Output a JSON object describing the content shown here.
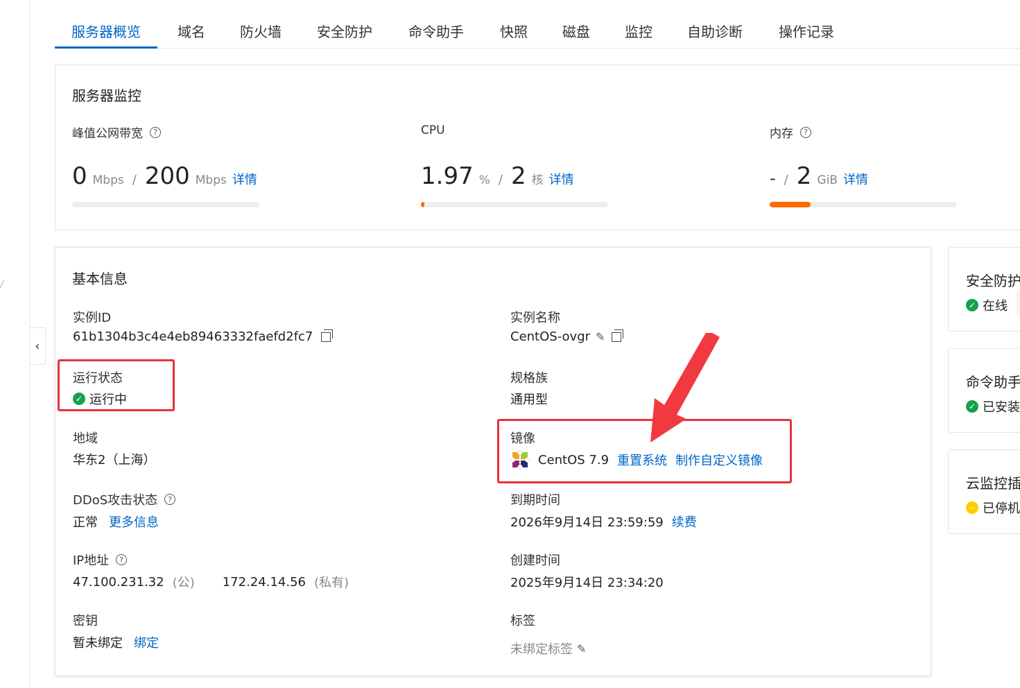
{
  "tabs": [
    "服务器概览",
    "域名",
    "防火墙",
    "安全防护",
    "命令助手",
    "快照",
    "磁盘",
    "监控",
    "自助诊断",
    "操作记录"
  ],
  "monitor": {
    "title": "服务器监控",
    "bandwidth": {
      "label": "峰值公网带宽",
      "used": "0",
      "used_unit": "Mbps",
      "total": "200",
      "total_unit": "Mbps",
      "link": "详情",
      "usage_fraction": 0.0
    },
    "cpu": {
      "label": "CPU",
      "used": "1.97",
      "used_unit": "%",
      "total": "2",
      "total_unit": "核",
      "link": "详情",
      "usage_fraction": 0.02
    },
    "memory": {
      "label": "内存",
      "used": "-",
      "total": "2",
      "total_unit": "GiB",
      "link": "详情",
      "usage_fraction": 0.22
    }
  },
  "basic": {
    "title": "基本信息",
    "instance_id": {
      "label": "实例ID",
      "value": "61b1304b3c4e4eb89463332faefd2fc7"
    },
    "instance_name": {
      "label": "实例名称",
      "value": "CentOS-ovgr"
    },
    "run_status": {
      "label": "运行状态",
      "value": "运行中"
    },
    "spec_family": {
      "label": "规格族",
      "value": "通用型"
    },
    "region": {
      "label": "地域",
      "value": "华东2（上海）"
    },
    "image": {
      "label": "镜像",
      "value": "CentOS 7.9",
      "reset_link": "重置系统",
      "custom_link": "制作自定义镜像"
    },
    "ddos": {
      "label": "DDoS攻击状态",
      "value": "正常",
      "link": "更多信息"
    },
    "expire": {
      "label": "到期时间",
      "value": "2026年9月14日 23:59:59",
      "link": "续费"
    },
    "ip": {
      "label": "IP地址",
      "public": "47.100.231.32",
      "public_tag": "(公)",
      "private": "172.24.14.56",
      "private_tag": "(私有)"
    },
    "created": {
      "label": "创建时间",
      "value": "2025年9月14日 23:34:20"
    },
    "keypair": {
      "label": "密钥",
      "value": "暂未绑定",
      "link": "绑定"
    },
    "tags": {
      "label": "标签",
      "value": "未绑定标签"
    }
  },
  "side_cards": [
    {
      "title": "安全防护",
      "status": "在线",
      "color": "#13a34a"
    },
    {
      "title": "命令助手",
      "status": "已安装",
      "color": "#13a34a"
    },
    {
      "title": "云监控插",
      "status": "已停机",
      "color": "#ffcc00"
    }
  ],
  "colors": {
    "accent": "#0064c8",
    "highlight": "#e8313a",
    "progress": "#ff6a00",
    "ok": "#13a34a"
  }
}
